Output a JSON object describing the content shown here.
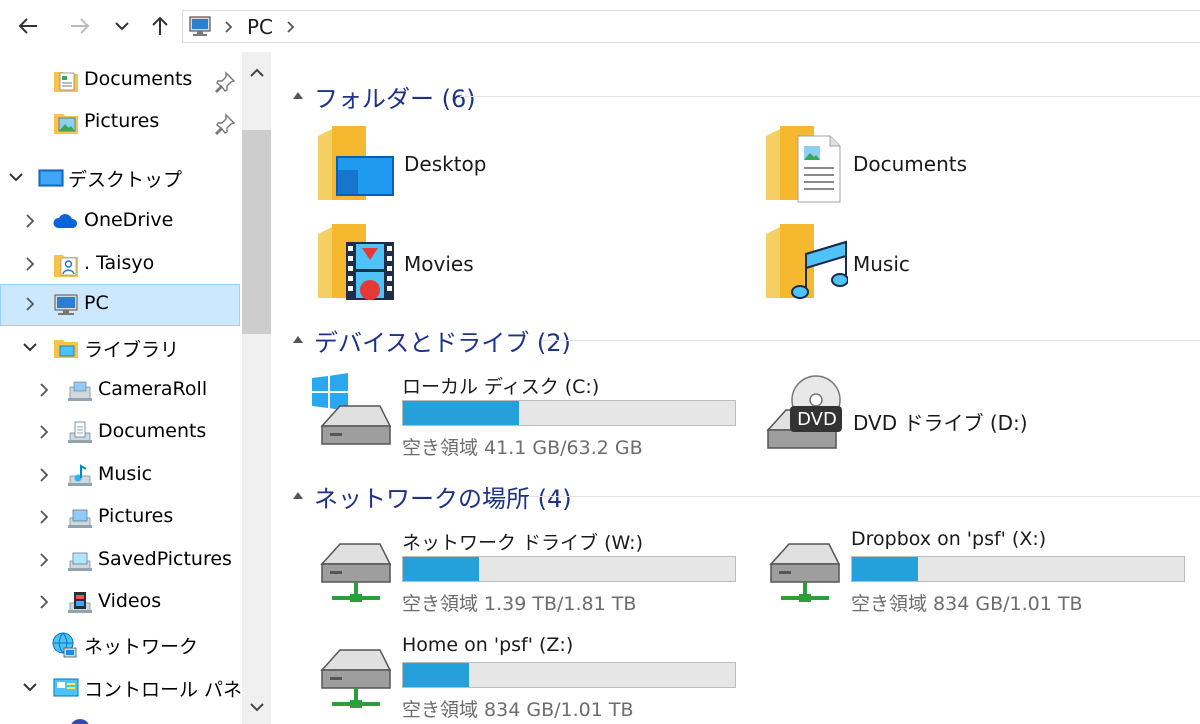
{
  "breadcrumb": {
    "location": "PC"
  },
  "sidebar": {
    "items": [
      {
        "id": "documents-quick",
        "label": "Documents",
        "pinned": true
      },
      {
        "id": "pictures-quick",
        "label": "Pictures",
        "pinned": true
      },
      {
        "id": "desktop",
        "label": "デスクトップ",
        "expanded": true
      },
      {
        "id": "onedrive",
        "label": "OneDrive"
      },
      {
        "id": "user",
        "label": ". Taisyo"
      },
      {
        "id": "pc",
        "label": "PC",
        "selected": true
      },
      {
        "id": "libraries",
        "label": "ライブラリ",
        "expanded": true
      },
      {
        "id": "cameraroll",
        "label": "CameraRoll"
      },
      {
        "id": "lib-documents",
        "label": "Documents"
      },
      {
        "id": "lib-music",
        "label": "Music"
      },
      {
        "id": "lib-pictures",
        "label": "Pictures"
      },
      {
        "id": "savedpictures",
        "label": "SavedPictures"
      },
      {
        "id": "videos",
        "label": "Videos"
      },
      {
        "id": "network",
        "label": "ネットワーク"
      },
      {
        "id": "control-panel",
        "label": "コントロール パネル",
        "expanded": true
      }
    ]
  },
  "groups": {
    "folders": {
      "title": "フォルダー (6)",
      "items": [
        {
          "name": "Desktop"
        },
        {
          "name": "Documents"
        },
        {
          "name": "Movies"
        },
        {
          "name": "Music"
        }
      ]
    },
    "devices": {
      "title": "デバイスとドライブ (2)",
      "drives": [
        {
          "name": "ローカル ディスク (C:)",
          "used_fraction": 0.35,
          "space": "空き領域 41.1 GB/63.2 GB"
        }
      ],
      "dvd": {
        "name": "DVD ドライブ (D:)",
        "badge": "DVD"
      }
    },
    "network": {
      "title": "ネットワークの場所 (4)",
      "drives": [
        {
          "name": "ネットワーク ドライブ (W:)",
          "used_fraction": 0.23,
          "space": "空き領域 1.39 TB/1.81 TB"
        },
        {
          "name": "Dropbox on 'psf' (X:)",
          "used_fraction": 0.2,
          "space": "空き領域 834 GB/1.01 TB"
        },
        {
          "name": "Home on 'psf' (Z:)",
          "used_fraction": 0.2,
          "space": "空き領域 834 GB/1.01 TB"
        }
      ]
    }
  },
  "colors": {
    "accent": "#26a0da",
    "group_title": "#1e3287",
    "selection": "#cce8ff"
  }
}
